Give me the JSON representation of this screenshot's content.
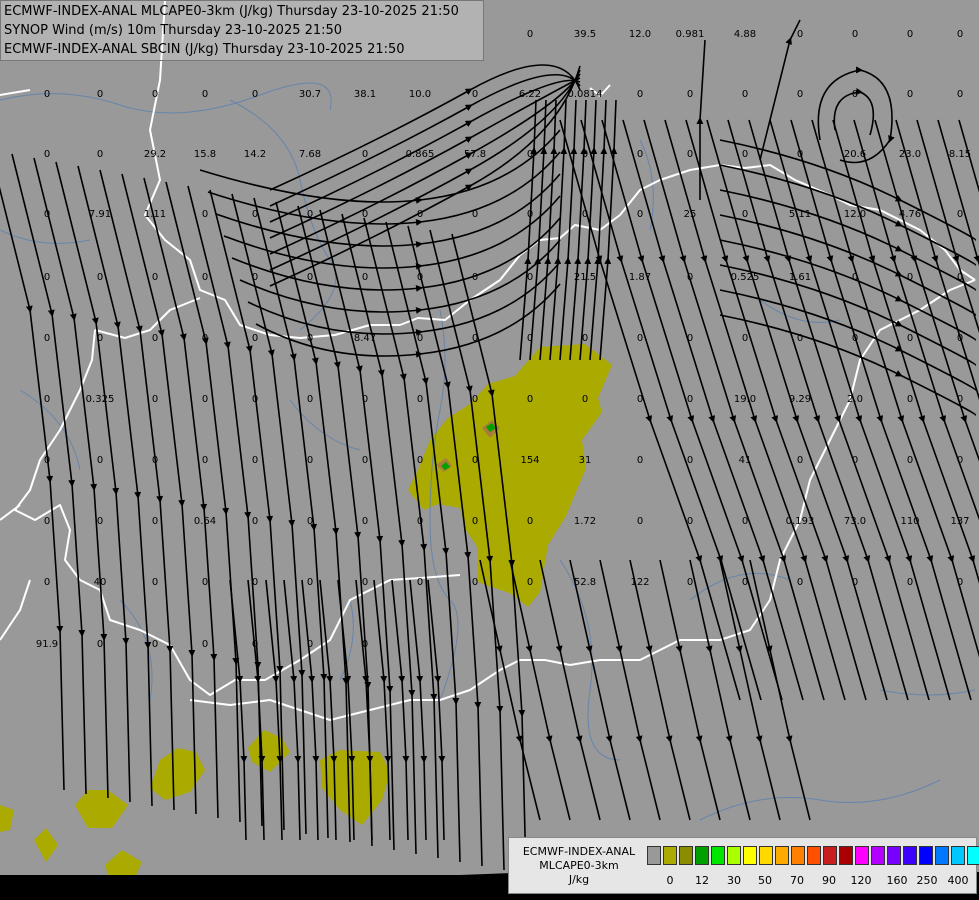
{
  "header": {
    "line1": "ECMWF-INDEX-ANAL MLCAPE0-3km (J/kg) Thursday 23-10-2025 21:50",
    "line2": "SYNOP Wind (m/s) 10m Thursday 23-10-2025 21:50",
    "line3": "ECMWF-INDEX-ANAL SBCIN (J/kg) Thursday 23-10-2025 21:50"
  },
  "legend": {
    "title1": "ECMWF-INDEX-ANAL",
    "title2": "MLCAPE0-3km",
    "unit": "J/kg",
    "colors": [
      "#999999",
      "#aaaa00",
      "#8c8c00",
      "#00a000",
      "#00e600",
      "#aaff00",
      "#ffff00",
      "#ffd800",
      "#ffaa00",
      "#ff8000",
      "#ff5000",
      "#c81e1e",
      "#aa0000",
      "#ff00ff",
      "#b400ff",
      "#7800ff",
      "#3c00ff",
      "#0000ff",
      "#0078ff",
      "#00c8ff",
      "#00ffff",
      "#aaffff",
      "#ffffff"
    ],
    "tick_labels": [
      "0",
      "12",
      "30",
      "50",
      "70",
      "90",
      "120",
      "160",
      "250",
      "400"
    ]
  },
  "map_colors": {
    "background": "#999999",
    "cape_low": "#aaaa00",
    "cape_mid": "#a87d3a",
    "cape_green": "#00a000",
    "border": "#ffffff",
    "river": "#5a7fb0",
    "streamline": "#000000"
  },
  "station_values": [
    "0",
    "39.5",
    "12.0",
    "0.981",
    "4.88",
    "0",
    "0",
    "0",
    "0",
    "0",
    "0",
    "0",
    "0",
    "0",
    "30.7",
    "38.1",
    "10.0",
    "0",
    "6.22",
    "0.0814",
    "0",
    "0",
    "0",
    "0",
    "0",
    "0",
    "0",
    "0",
    "0",
    "29.2",
    "15.8",
    "14.2",
    "7.68",
    "0",
    "0.865",
    "57.8",
    "0",
    "0",
    "0",
    "0",
    "0",
    "0",
    "20.6",
    "23.0",
    "8.15",
    "0",
    "7.91",
    "1.11",
    "0",
    "0",
    "0",
    "0",
    "0",
    "0",
    "0",
    "0",
    "0",
    "25",
    "0",
    "5.11",
    "12.0",
    "4.76",
    "0",
    "0",
    "0",
    "0",
    "0",
    "0",
    "0",
    "0",
    "0",
    "0",
    "0",
    "21.5",
    "1.87",
    "0",
    "0.525",
    "1.61",
    "0",
    "0",
    "0",
    "0",
    "0",
    "0",
    "0",
    "0",
    "0",
    "8.47",
    "0",
    "0",
    "0",
    "0",
    "0",
    "0",
    "0",
    "0",
    "0",
    "0",
    "0",
    "0",
    "0.325",
    "0",
    "0",
    "0",
    "0",
    "0",
    "0",
    "0",
    "0",
    "0",
    "0",
    "0",
    "19.0",
    "9.29",
    "2.0",
    "0",
    "0",
    "0",
    "0",
    "0",
    "0",
    "0",
    "0",
    "0",
    "0",
    "0",
    "154",
    "31",
    "0",
    "0",
    "41",
    "0",
    "0",
    "0",
    "0",
    "0",
    "0",
    "0",
    "0.64",
    "0",
    "0",
    "0",
    "0",
    "0",
    "0",
    "1.72",
    "0",
    "0",
    "0",
    "0.193",
    "73.0",
    "110",
    "137",
    "0",
    "40",
    "0",
    "0",
    "0",
    "0",
    "0",
    "0",
    "0",
    "0",
    "52.8",
    "122",
    "0",
    "0",
    "0",
    "0",
    "0",
    "0",
    "91.9",
    "0",
    "0",
    "0",
    "0",
    "0",
    "0"
  ]
}
